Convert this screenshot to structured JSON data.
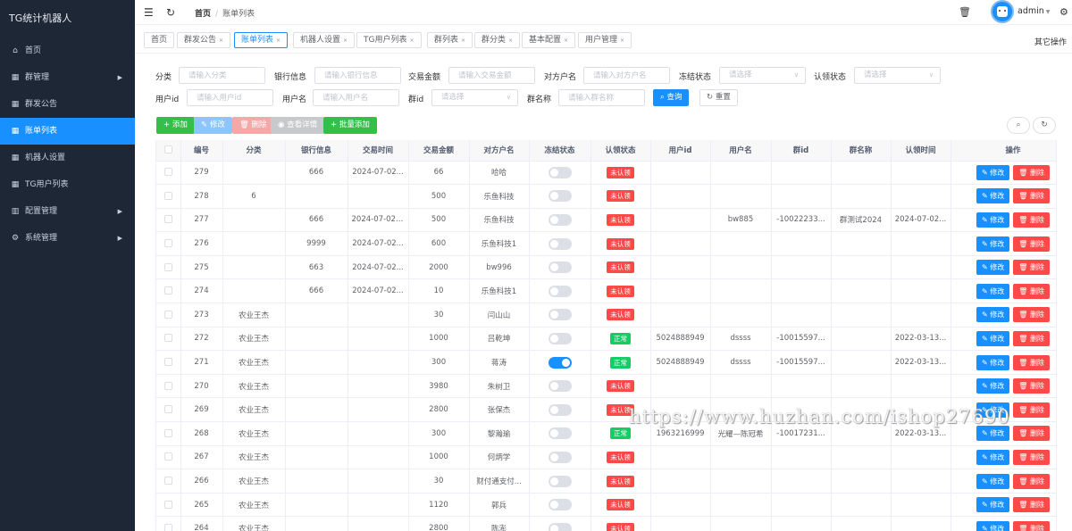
{
  "app": {
    "title": "TG统计机器人"
  },
  "sidebar": {
    "items": [
      {
        "label": "首页",
        "icon": "home-icon",
        "glyph": "⌂",
        "arrow": false
      },
      {
        "label": "群管理",
        "icon": "grid-icon",
        "glyph": "▦",
        "arrow": true
      },
      {
        "label": "群发公告",
        "icon": "grid-icon",
        "glyph": "▦",
        "arrow": false
      },
      {
        "label": "账单列表",
        "icon": "grid-icon",
        "glyph": "▦",
        "arrow": false,
        "active": true
      },
      {
        "label": "机器人设置",
        "icon": "grid-icon",
        "glyph": "▦",
        "arrow": false
      },
      {
        "label": "TG用户列表",
        "icon": "grid-icon",
        "glyph": "▦",
        "arrow": false
      },
      {
        "label": "配置管理",
        "icon": "bar-chart-icon",
        "glyph": "▥",
        "arrow": true
      },
      {
        "label": "系统管理",
        "icon": "gear-icon",
        "glyph": "⚙",
        "arrow": true
      }
    ]
  },
  "header": {
    "breadcrumb_home": "首页",
    "breadcrumb_sep": "/",
    "breadcrumb_current": "账单列表",
    "username": "admin"
  },
  "tags": [
    {
      "label": "首页",
      "closable": false
    },
    {
      "label": "群发公告",
      "closable": true
    },
    {
      "label": "账单列表",
      "closable": true,
      "active": true
    },
    {
      "label": "机器人设置",
      "closable": true
    },
    {
      "label": "TG用户列表",
      "closable": true
    },
    {
      "label": "群列表",
      "closable": true
    },
    {
      "label": "群分类",
      "closable": true
    },
    {
      "label": "基本配置",
      "closable": true
    },
    {
      "label": "用户管理",
      "closable": true
    }
  ],
  "tags_more": "其它操作",
  "search": {
    "category_label": "分类",
    "category_ph": "请输入分类",
    "bank_label": "银行信息",
    "bank_ph": "请输入银行信息",
    "amount_label": "交易金额",
    "amount_ph": "请输入交易金额",
    "counter_label": "对方户名",
    "counter_ph": "请输入对方户名",
    "freeze_label": "冻结状态",
    "freeze_ph": "请选择",
    "claim_label": "认领状态",
    "claim_ph": "请选择",
    "userid_label": "用户id",
    "userid_ph": "请输入用户id",
    "username_label": "用户名",
    "username_ph": "请输入用户名",
    "groupid_label": "群id",
    "groupid_ph": "请选择",
    "groupname_label": "群名称",
    "groupname_ph": "请输入群名称",
    "query_btn": "查询",
    "reset_btn": "重置"
  },
  "toolbar": {
    "add": "添加",
    "edit": "修改",
    "delete": "删除",
    "detail": "查看详情",
    "batch_add": "批量添加"
  },
  "table": {
    "columns": [
      "编号",
      "分类",
      "银行信息",
      "交易时间",
      "交易金额",
      "对方户名",
      "冻结状态",
      "认领状态",
      "用户id",
      "用户名",
      "群id",
      "群名称",
      "认领时间",
      "操作"
    ],
    "edit_label": "修改",
    "delete_label": "删除",
    "rows": [
      {
        "id": "279",
        "cat": "",
        "bank": "666",
        "time": "2024-07-02...",
        "amount": "66",
        "counter": "哈哈",
        "frozen": false,
        "status": "未认领",
        "claimed": false,
        "uid": "",
        "uname": "",
        "gid": "",
        "gname": "",
        "ctime": ""
      },
      {
        "id": "278",
        "cat": "6",
        "bank": "",
        "time": "",
        "amount": "500",
        "counter": "乐鱼科技",
        "frozen": false,
        "status": "未认领",
        "claimed": false,
        "uid": "",
        "uname": "",
        "gid": "",
        "gname": "",
        "ctime": ""
      },
      {
        "id": "277",
        "cat": "",
        "bank": "666",
        "time": "2024-07-022...",
        "amount": "500",
        "counter": "乐鱼科技",
        "frozen": false,
        "status": "未认领",
        "claimed": false,
        "uid": "",
        "uname": "bw885",
        "gid": "-10022233...",
        "gname": "群测试2024",
        "ctime": "2024-07-02..."
      },
      {
        "id": "276",
        "cat": "",
        "bank": "9999",
        "time": "2024-07-02...",
        "amount": "600",
        "counter": "乐鱼科技1",
        "frozen": false,
        "status": "未认领",
        "claimed": false,
        "uid": "",
        "uname": "",
        "gid": "",
        "gname": "",
        "ctime": ""
      },
      {
        "id": "275",
        "cat": "",
        "bank": "663",
        "time": "2024-07-02...",
        "amount": "2000",
        "counter": "bw996",
        "frozen": false,
        "status": "未认领",
        "claimed": false,
        "uid": "",
        "uname": "",
        "gid": "",
        "gname": "",
        "ctime": ""
      },
      {
        "id": "274",
        "cat": "",
        "bank": "666",
        "time": "2024-07-02...",
        "amount": "10",
        "counter": "乐鱼科技1",
        "frozen": false,
        "status": "未认领",
        "claimed": false,
        "uid": "",
        "uname": "",
        "gid": "",
        "gname": "",
        "ctime": ""
      },
      {
        "id": "273",
        "cat": "农业王杰",
        "bank": "",
        "time": "",
        "amount": "30",
        "counter": "闫山山",
        "frozen": false,
        "status": "未认领",
        "claimed": false,
        "uid": "",
        "uname": "",
        "gid": "",
        "gname": "",
        "ctime": ""
      },
      {
        "id": "272",
        "cat": "农业王杰",
        "bank": "",
        "time": "",
        "amount": "1000",
        "counter": "吕乾坤",
        "frozen": false,
        "status": "正常",
        "claimed": true,
        "uid": "5024888949",
        "uname": "dssss",
        "gid": "-10015597...",
        "gname": "",
        "ctime": "2022-03-13..."
      },
      {
        "id": "271",
        "cat": "农业王杰",
        "bank": "",
        "time": "",
        "amount": "300",
        "counter": "蒋涛",
        "frozen": true,
        "status": "正常",
        "claimed": true,
        "uid": "5024888949",
        "uname": "dssss",
        "gid": "-10015597...",
        "gname": "",
        "ctime": "2022-03-13..."
      },
      {
        "id": "270",
        "cat": "农业王杰",
        "bank": "",
        "time": "",
        "amount": "3980",
        "counter": "朱树卫",
        "frozen": false,
        "status": "未认领",
        "claimed": false,
        "uid": "",
        "uname": "",
        "gid": "",
        "gname": "",
        "ctime": ""
      },
      {
        "id": "269",
        "cat": "农业王杰",
        "bank": "",
        "time": "",
        "amount": "2800",
        "counter": "张保杰",
        "frozen": false,
        "status": "未认领",
        "claimed": false,
        "uid": "",
        "uname": "",
        "gid": "",
        "gname": "",
        "ctime": ""
      },
      {
        "id": "268",
        "cat": "农业王杰",
        "bank": "",
        "time": "",
        "amount": "300",
        "counter": "黎瀚瑜",
        "frozen": false,
        "status": "正常",
        "claimed": true,
        "uid": "1963216999",
        "uname": "光耀—陈冠希",
        "gid": "-10017231...",
        "gname": "",
        "ctime": "2022-03-13..."
      },
      {
        "id": "267",
        "cat": "农业王杰",
        "bank": "",
        "time": "",
        "amount": "1000",
        "counter": "何炳学",
        "frozen": false,
        "status": "未认领",
        "claimed": false,
        "uid": "",
        "uname": "",
        "gid": "",
        "gname": "",
        "ctime": ""
      },
      {
        "id": "266",
        "cat": "农业王杰",
        "bank": "",
        "time": "",
        "amount": "30",
        "counter": "财付通支付...",
        "frozen": false,
        "status": "未认领",
        "claimed": false,
        "uid": "",
        "uname": "",
        "gid": "",
        "gname": "",
        "ctime": ""
      },
      {
        "id": "265",
        "cat": "农业王杰",
        "bank": "",
        "time": "",
        "amount": "1120",
        "counter": "郭兵",
        "frozen": false,
        "status": "未认领",
        "claimed": false,
        "uid": "",
        "uname": "",
        "gid": "",
        "gname": "",
        "ctime": ""
      },
      {
        "id": "264",
        "cat": "农业王杰",
        "bank": "",
        "time": "",
        "amount": "2800",
        "counter": "陈澎",
        "frozen": false,
        "status": "未认领",
        "claimed": false,
        "uid": "",
        "uname": "",
        "gid": "",
        "gname": "",
        "ctime": ""
      }
    ]
  },
  "watermark": "https://www.huzhan.com/ishop27690",
  "colors": {
    "primary": "#1890ff",
    "sidebar_bg": "#1e2736",
    "danger": "#ff4949",
    "success": "#13ce66",
    "add_green": "#34bf49"
  }
}
